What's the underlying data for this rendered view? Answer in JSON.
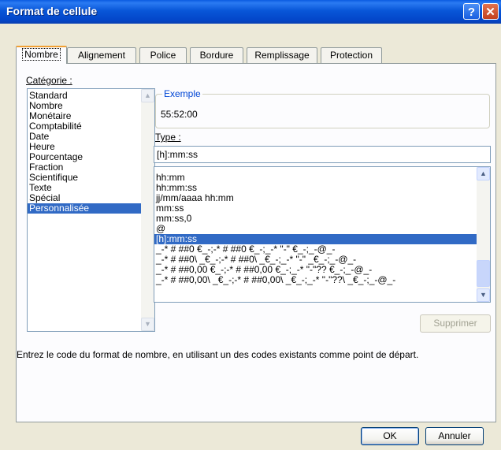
{
  "window": {
    "title": "Format de cellule"
  },
  "tabs": [
    {
      "label": "Nombre",
      "active": true
    },
    {
      "label": "Alignement",
      "active": false
    },
    {
      "label": "Police",
      "active": false
    },
    {
      "label": "Bordure",
      "active": false
    },
    {
      "label": "Remplissage",
      "active": false
    },
    {
      "label": "Protection",
      "active": false
    }
  ],
  "category": {
    "label": "Catégorie :",
    "items": [
      "Standard",
      "Nombre",
      "Monétaire",
      "Comptabilité",
      "Date",
      "Heure",
      "Pourcentage",
      "Fraction",
      "Scientifique",
      "Texte",
      "Spécial",
      "Personnalisée"
    ],
    "selected": "Personnalisée"
  },
  "sample": {
    "legend": "Exemple",
    "value": "55:52:00"
  },
  "type": {
    "label": "Type :",
    "value": "[h]:mm:ss",
    "items": [
      "hh:mm",
      "hh:mm:ss",
      "jj/mm/aaaa hh:mm",
      "mm:ss",
      "mm:ss,0",
      "@",
      "[h]:mm:ss",
      "_-* # ##0 €_-;-* # ##0 €_-;_-* \"-\" €_-;_-@_-",
      "_-* # ##0\\ _€_-;-* # ##0\\ _€_-;_-* \"-\" _€_-;_-@_-",
      "_-* # ##0,00 €_-;-* # ##0,00 €_-;_-* \"-\"?? €_-;_-@_-",
      "_-* # ##0,00\\ _€_-;-* # ##0,00\\ _€_-;_-* \"-\"??\\ _€_-;_-@_-"
    ],
    "selected": "[h]:mm:ss"
  },
  "buttons": {
    "delete": "Supprimer",
    "ok": "OK",
    "cancel": "Annuler"
  },
  "description": "Entrez le code du format de nombre, en utilisant un des codes existants comme point de départ.",
  "icons": {
    "help": "help-icon",
    "close": "close-icon",
    "scroll_up": "chevron-up-icon",
    "scroll_down": "chevron-down-icon"
  }
}
